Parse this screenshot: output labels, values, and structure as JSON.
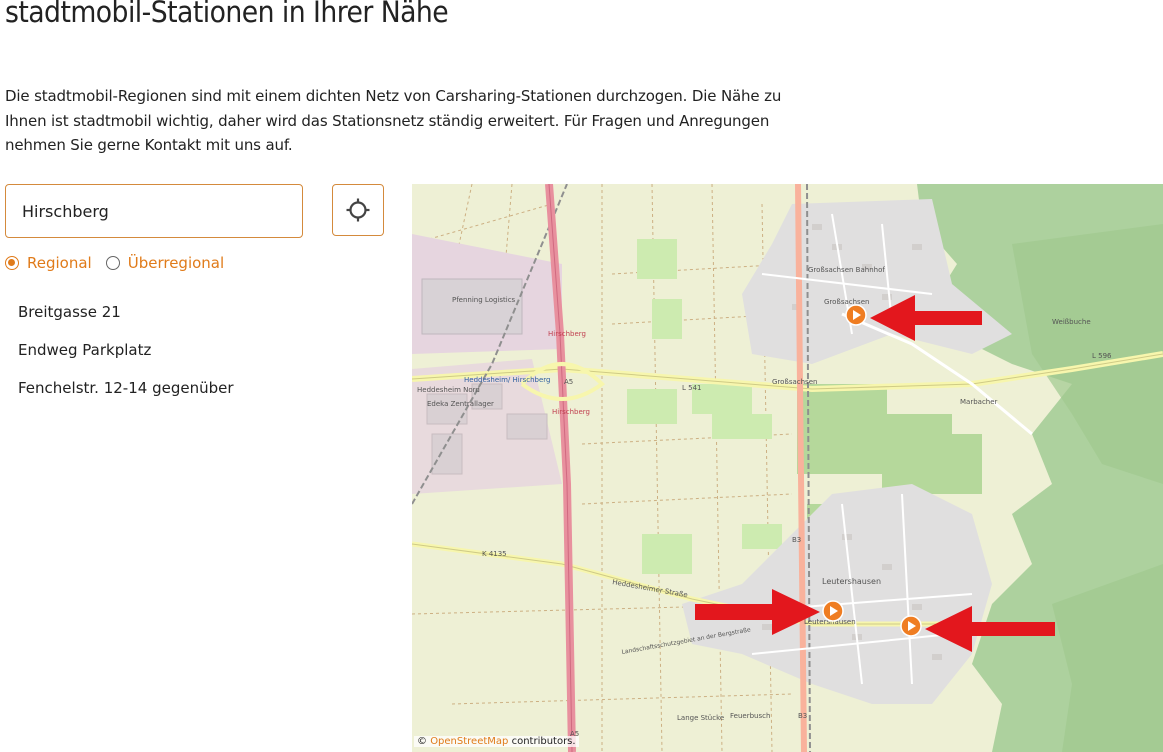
{
  "page": {
    "title": "stadtmobil-Stationen in Ihrer Nähe",
    "intro": "Die stadtmobil-Regionen sind mit einem dichten Netz von Carsharing-Stationen durchzogen. Die Nähe zu Ihnen ist stadtmobil wichtig, daher wird das Stationsnetz ständig erweitert. Für Fragen und Anregungen nehmen Sie gerne Kontakt mit uns auf."
  },
  "search": {
    "value": "Hirschberg",
    "locate_icon": "crosshair-icon"
  },
  "filter": {
    "options": [
      {
        "label": "Regional",
        "checked": true
      },
      {
        "label": "Überregional",
        "checked": false
      }
    ]
  },
  "stations": [
    {
      "name": "Breitgasse 21"
    },
    {
      "name": "Endweg Parkplatz"
    },
    {
      "name": "Fenchelstr. 12-14 gegenüber"
    }
  ],
  "map": {
    "labels": {
      "grosssachsen_bahnhof": "Großsachsen Bahnhof",
      "grosssachsen": "Großsachsen",
      "grosssachsen_street": "Großsachsen",
      "leutershausen": "Leutershausen",
      "pfenning": "Pfenning Logistics",
      "heddesheim_nord": "Heddesheim Nord",
      "heddesheim_hirschberg": "Heddesheim/ Hirschberg",
      "edeka": "Edeka Zentrallager",
      "hirschberg_1": "Hirschberg",
      "hirschberg_2": "Hirschberg",
      "a5_1": "A5",
      "a5_2": "A5",
      "b3_1": "B3",
      "b3_2": "B3",
      "l541": "L 541",
      "l596": "L 596",
      "k4135": "K 4135",
      "heddesheimer": "Heddesheimer Straße",
      "lange_stuecke": "Lange Stücke",
      "feuerbusch": "Feuerbusch",
      "bergstrasse": "Landschaftsschutzgebiet an der Bergstraße",
      "weilbuche": "Weißbuche",
      "massenbach": "Marbacher",
      "leutershausen_station": "Leutershausen"
    },
    "marker_icon": "station-marker-icon",
    "arrow_icon": "red-arrow-icon",
    "colors": {
      "marker": "#ef7d22",
      "arrow": "#e3171d",
      "motorway": "#e8909e",
      "forest": "#add19e",
      "farmland": "#eef0d5",
      "urban": "#e0dfdf"
    }
  },
  "attribution": {
    "prefix": "©",
    "link": "OpenStreetMap",
    "suffix": "contributors."
  }
}
